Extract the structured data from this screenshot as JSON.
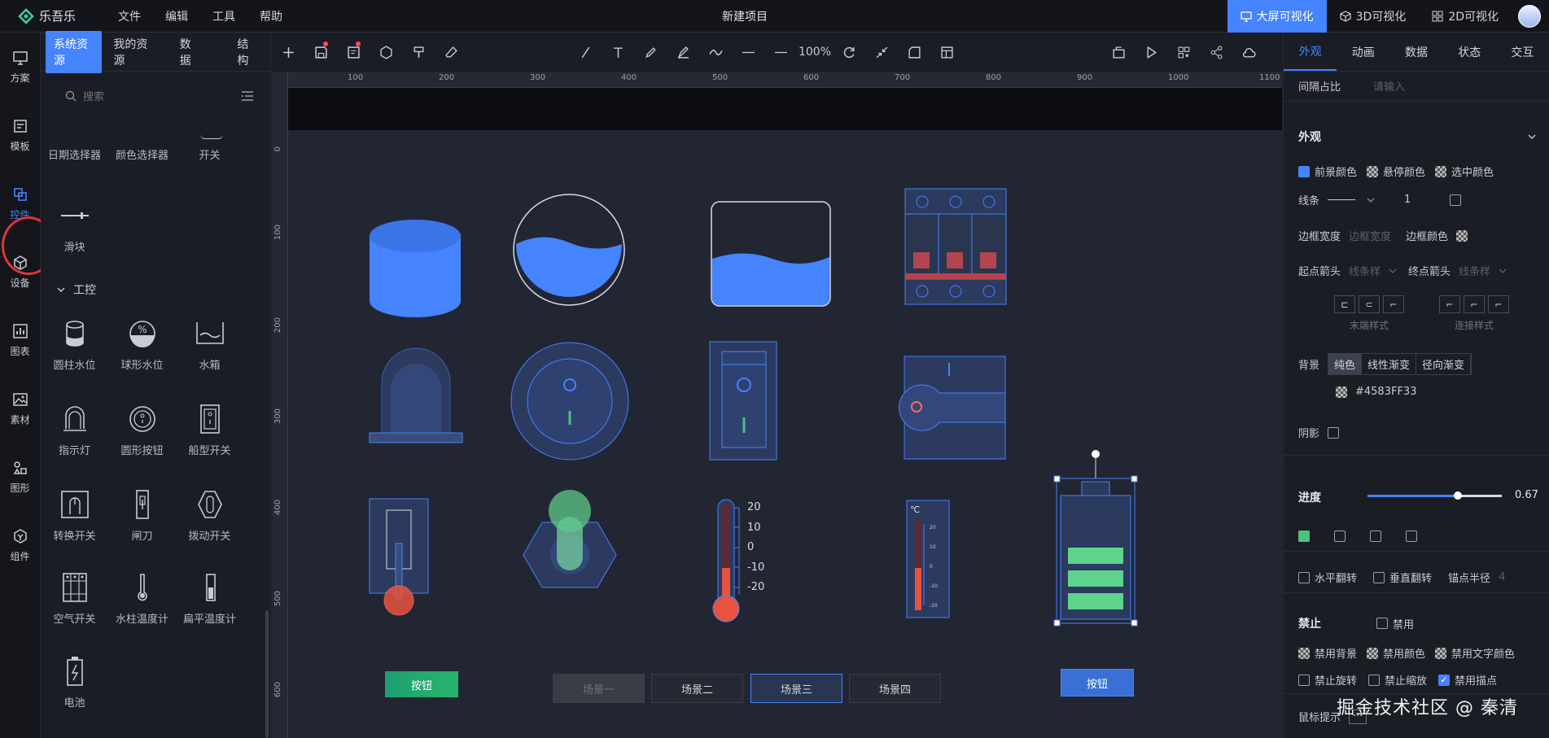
{
  "app": {
    "name": "乐吾乐",
    "project_title": "新建项目"
  },
  "menu": [
    "文件",
    "编辑",
    "工具",
    "帮助"
  ],
  "modes": [
    {
      "label": "大屏可视化",
      "active": true
    },
    {
      "label": "3D可视化",
      "active": false
    },
    {
      "label": "2D可视化",
      "active": false
    }
  ],
  "icon_sidebar": [
    {
      "label": "方案",
      "icon": "monitor-icon"
    },
    {
      "label": "模板",
      "icon": "template-icon"
    },
    {
      "label": "控件",
      "icon": "widget-icon",
      "active": true
    },
    {
      "label": "设备",
      "icon": "cube-icon"
    },
    {
      "label": "图表",
      "icon": "chart-icon"
    },
    {
      "label": "素材",
      "icon": "image-icon"
    },
    {
      "label": "图形",
      "icon": "shape-icon"
    },
    {
      "label": "组件",
      "icon": "component-icon"
    }
  ],
  "library": {
    "tabs": [
      "系统资源",
      "我的资源",
      "数据",
      "结构"
    ],
    "search_placeholder": "搜索",
    "top_items": [
      "日期选择器",
      "颜色选择器",
      "开关"
    ],
    "slider_item": "滑块",
    "section": "工控",
    "items": [
      "圆柱水位",
      "球形水位",
      "水箱",
      "指示灯",
      "圆形按钮",
      "船型开关",
      "转换开关",
      "闸刀",
      "拨动开关",
      "空气开关",
      "水柱温度计",
      "扁平温度计",
      "电池"
    ]
  },
  "toolbar": {
    "zoom": "100%"
  },
  "ruler": {
    "h": [
      "100",
      "200",
      "300",
      "400",
      "500",
      "600",
      "700",
      "800",
      "900",
      "1000",
      "1100"
    ],
    "v": [
      "0",
      "100",
      "200",
      "300",
      "400",
      "500",
      "600"
    ]
  },
  "canvas": {
    "button_label": "按钮",
    "scenes": [
      "场景一",
      "场景二",
      "场景三",
      "场景四"
    ],
    "thermo_ticks": [
      "20",
      "10",
      "0",
      "-10",
      "-20"
    ],
    "flat_unit": "℃",
    "flat_ticks": [
      "20",
      "10",
      "0",
      "-10",
      "-20"
    ],
    "button2_label": "按钮"
  },
  "right_panel": {
    "tabs": [
      "外观",
      "动画",
      "数据",
      "状态",
      "交互"
    ],
    "spacing_label": "间隔占比",
    "spacing_placeholder": "请输入",
    "section_appearance": "外观",
    "fg_color": "前景颜色",
    "hover_color": "悬停颜色",
    "selected_color": "选中颜色",
    "line_label": "线条",
    "line_width": "1",
    "border_width_label": "边框宽度",
    "border_width_placeholder": "边框宽度",
    "border_color_label": "边框颜色",
    "start_arrow_label": "起点箭头",
    "start_arrow_placeholder": "线条样",
    "end_arrow_label": "终点箭头",
    "end_arrow_placeholder": "线条样",
    "end_style_label": "末端样式",
    "join_style_label": "连接样式",
    "bg_label": "背景",
    "bg_options": [
      "纯色",
      "线性渐变",
      "径向渐变"
    ],
    "bg_color_value": "#4583FF33",
    "shadow_label": "阴影",
    "progress_label": "进度",
    "progress_value": "0.67",
    "progress": 0.67,
    "flip_h": "水平翻转",
    "flip_v": "垂直翻转",
    "anchor_radius_label": "锚点半径",
    "anchor_radius_value": "4",
    "disable_section": "禁止",
    "disable_label": "禁用",
    "disable_bg": "禁用背景",
    "disable_color": "禁用颜色",
    "disable_text_color": "禁用文字颜色",
    "disable_rotate": "禁止旋转",
    "disable_scale": "禁止缩放",
    "disable_anchor": "禁用描点",
    "mouse_tip": "鼠标提示",
    "accent": "#4583FF"
  },
  "watermark": "掘金技术社区 @ 秦清"
}
